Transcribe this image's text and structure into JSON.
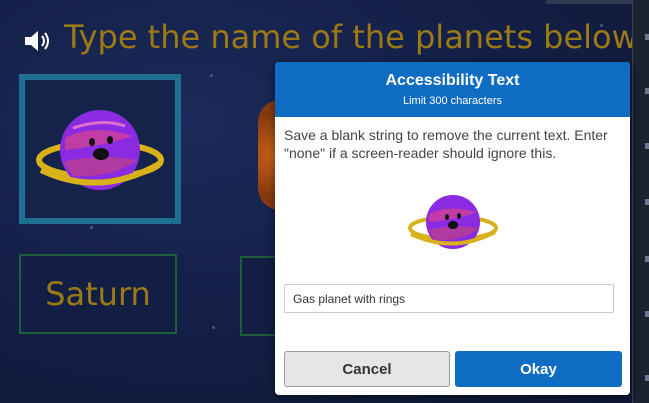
{
  "background": {
    "instruction": "Type the name of the planets below",
    "answer_box": "Saturn"
  },
  "modal": {
    "title": "Accessibility Text",
    "subtitle": "Limit 300 characters",
    "description": "Save a blank string to remove the current text. Enter \"none\" if a screen-reader should ignore this.",
    "input_value": "Gas planet with rings",
    "cancel_label": "Cancel",
    "okay_label": "Okay"
  },
  "colors": {
    "accent": "#0f6cc3",
    "title_gold": "#9b7a14"
  },
  "icons": [
    "speaker-icon",
    "saturn-planet-image"
  ]
}
